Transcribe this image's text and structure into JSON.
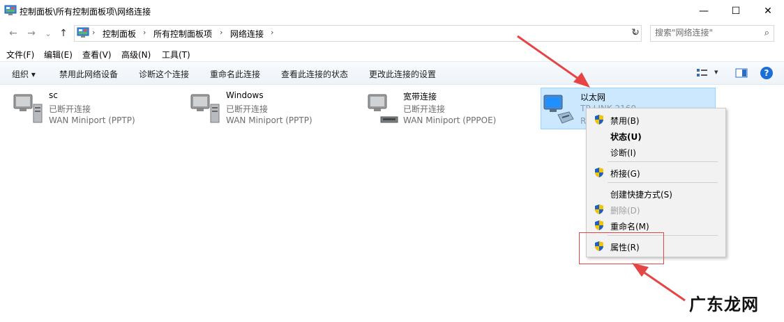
{
  "window": {
    "title": "控制面板\\所有控制面板项\\网络连接",
    "minimize_glyph": "—",
    "maximize_glyph": "☐",
    "close_glyph": "✕"
  },
  "nav": {
    "back_glyph": "←",
    "forward_glyph": "→",
    "recent_glyph": "⌄",
    "up_glyph": "↑",
    "refresh_glyph": "↻",
    "breadcrumb": [
      "控制面板",
      "所有控制面板项",
      "网络连接"
    ],
    "sep_glyph": "›",
    "dropdown_glyph": "⌄"
  },
  "search": {
    "placeholder": "搜索\"网络连接\"",
    "icon_glyph": "⌕"
  },
  "menu": [
    "文件(F)",
    "编辑(E)",
    "查看(V)",
    "高级(N)",
    "工具(T)"
  ],
  "toolbar": {
    "organize": "组织 ▾",
    "items": [
      "禁用此网络设备",
      "诊断这个连接",
      "重命名此连接",
      "查看此连接的状态",
      "更改此连接的设置"
    ],
    "view_dropdown_glyph": "▾",
    "help_glyph": "?"
  },
  "connections": [
    {
      "name": "sc",
      "status": "已断开连接",
      "device": "WAN Miniport (PPTP)"
    },
    {
      "name": "Windows",
      "status": "已断开连接",
      "device": "WAN Miniport (PPTP)"
    },
    {
      "name": "宽带连接",
      "status": "已断开连接",
      "device": "WAN Miniport (PPPOE)"
    },
    {
      "name": "以太网",
      "status": "TP-LINK 2160",
      "device": "R"
    }
  ],
  "context_menu": {
    "items": [
      {
        "label": "禁用(B)",
        "shield": true,
        "style": "normal"
      },
      {
        "label": "状态(U)",
        "shield": false,
        "style": "bold"
      },
      {
        "label": "诊断(I)",
        "shield": false,
        "style": "normal"
      },
      {
        "label": "桥接(G)",
        "shield": true,
        "style": "normal"
      },
      {
        "label": "创建快捷方式(S)",
        "shield": false,
        "style": "normal"
      },
      {
        "label": "删除(D)",
        "shield": true,
        "style": "disabled"
      },
      {
        "label": "重命名(M)",
        "shield": true,
        "style": "normal"
      },
      {
        "label": "属性(R)",
        "shield": true,
        "style": "normal"
      }
    ]
  },
  "watermark": "广东龙网",
  "colors": {
    "selection_bg": "#cce8ff",
    "annotation_red": "#e64545",
    "shield_blue": "#1f5fbf",
    "shield_yellow": "#f5c400"
  }
}
